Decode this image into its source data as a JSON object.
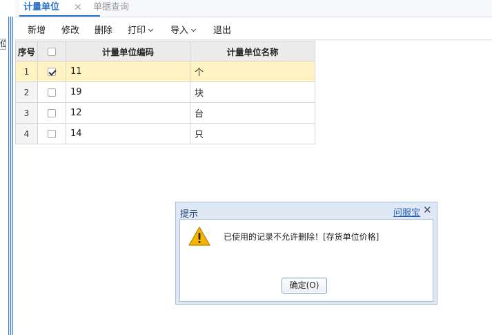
{
  "tabs": [
    {
      "label": "计量单位",
      "close": "✕"
    },
    {
      "label": "单据查询"
    }
  ],
  "left_stub_text": "位",
  "toolbar": {
    "add": "新增",
    "edit": "修改",
    "delete": "删除",
    "print": "打印",
    "import": "导入",
    "exit": "退出"
  },
  "table": {
    "headers": {
      "index": "序号",
      "code": "计量单位编码",
      "name": "计量单位名称"
    },
    "rows": [
      {
        "index": "1",
        "checked": true,
        "code": "11",
        "name": "个"
      },
      {
        "index": "2",
        "checked": false,
        "code": "19",
        "name": "块"
      },
      {
        "index": "3",
        "checked": false,
        "code": "12",
        "name": "台"
      },
      {
        "index": "4",
        "checked": false,
        "code": "14",
        "name": "只"
      }
    ]
  },
  "dialog": {
    "title": "提示",
    "help": "问服宝",
    "close": "✕",
    "message": "已使用的记录不允许删除！[存货单位价格]",
    "ok_label": "确定(O)"
  },
  "colors": {
    "accent": "#2a70c8",
    "selected_row": "#fff3c4",
    "warning": "#f5b400"
  }
}
